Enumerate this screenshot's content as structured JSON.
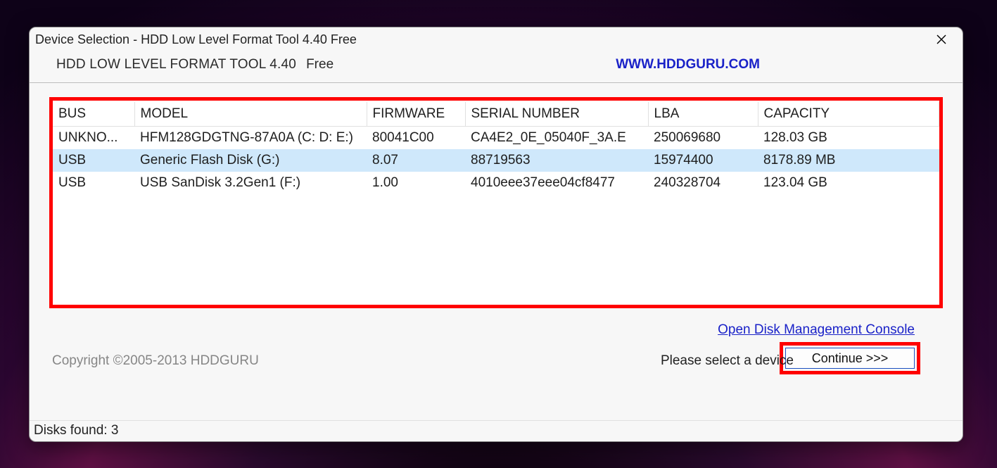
{
  "window": {
    "title": "Device Selection - HDD Low Level Format Tool 4.40    Free"
  },
  "header": {
    "app_name": "HDD LOW LEVEL FORMAT TOOL 4.40",
    "free_tag": "Free",
    "url": "WWW.HDDGURU.COM"
  },
  "table": {
    "headers": {
      "bus": "BUS",
      "model": "MODEL",
      "firmware": "FIRMWARE",
      "serial": "SERIAL NUMBER",
      "lba": "LBA",
      "capacity": "CAPACITY"
    },
    "rows": [
      {
        "bus": "UNKNO...",
        "model": "HFM128GDGTNG-87A0A (C: D: E:)",
        "firmware": "80041C00",
        "serial": "CA4E2_0E_05040F_3A.E",
        "lba": "250069680",
        "capacity": "128.03 GB",
        "selected": false
      },
      {
        "bus": "USB",
        "model": "Generic Flash Disk (G:)",
        "firmware": "8.07",
        "serial": "88719563",
        "lba": "15974400",
        "capacity": "8178.89 MB",
        "selected": true
      },
      {
        "bus": "USB",
        "model": "USB SanDisk 3.2Gen1 (F:)",
        "firmware": "1.00",
        "serial": "4010eee37eee04cf8477",
        "lba": "240328704",
        "capacity": "123.04 GB",
        "selected": false
      }
    ]
  },
  "links": {
    "disk_mgmt": "Open Disk Management Console"
  },
  "footer": {
    "copyright": "Copyright ©2005-2013 HDDGURU",
    "select_msg": "Please select a device",
    "continue_label": "Continue >>>"
  },
  "status": {
    "disks_found": "Disks found: 3"
  }
}
